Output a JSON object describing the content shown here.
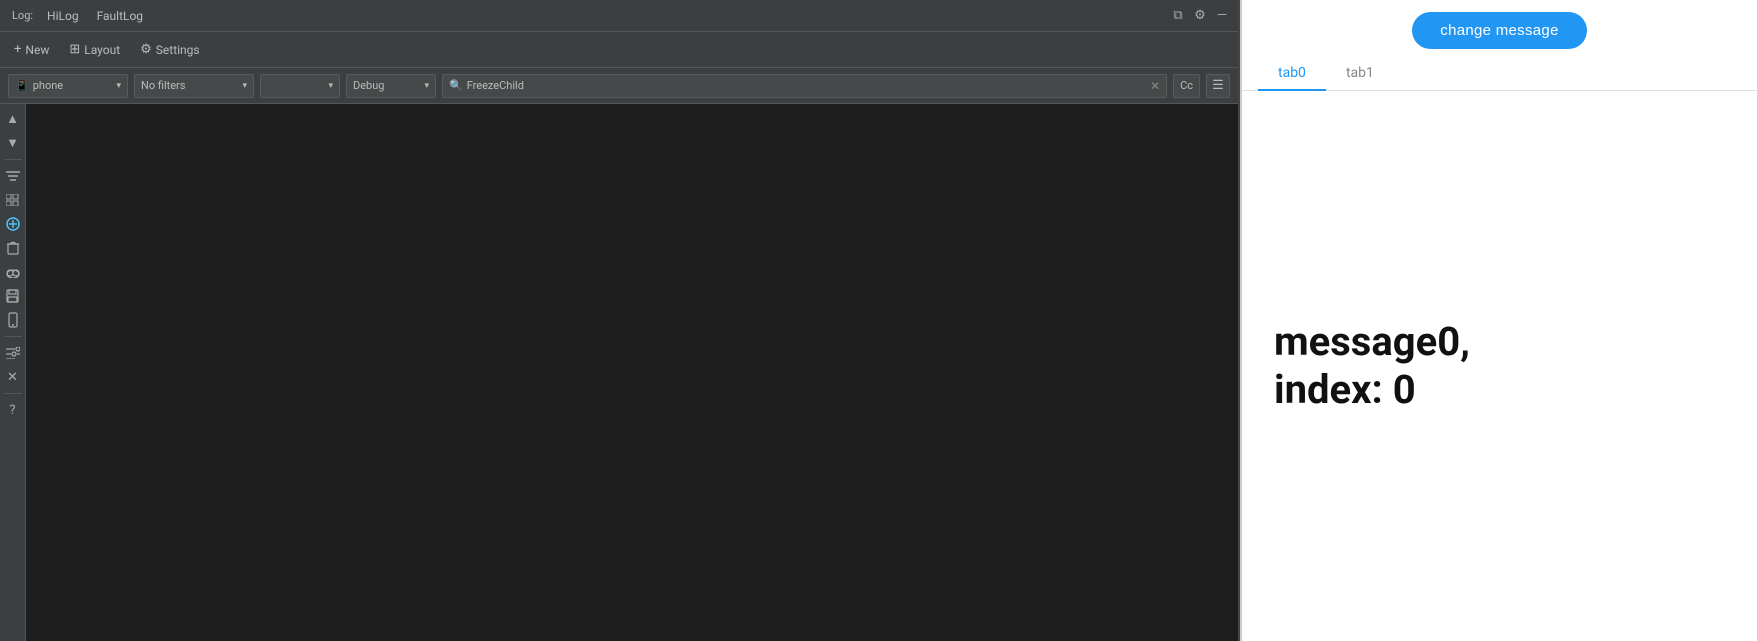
{
  "menu": {
    "app_label": "Log:",
    "hilog": "HiLog",
    "faultlog": "FaultLog",
    "window_buttons": {
      "restore": "⧉",
      "settings": "⚙",
      "minimize": "—"
    }
  },
  "toolbar": {
    "new_label": "New",
    "layout_label": "Layout",
    "settings_label": "Settings",
    "new_icon": "+",
    "layout_icon": "⊞",
    "settings_icon": "⚙"
  },
  "filter_bar": {
    "device_icon": "📱",
    "device_value": "phone",
    "device_arrow": "▾",
    "filter_value": "No filters",
    "filter_arrow": "▾",
    "package_value": "",
    "package_arrow": "▾",
    "level_value": "Debug",
    "level_arrow": "▾",
    "search_icon": "🔍",
    "search_value": "FreezeChild",
    "search_clear": "✕",
    "cc_label": "Cc",
    "filter_icon": "☰"
  },
  "sidebar": {
    "icons": [
      {
        "name": "arrow-up-icon",
        "symbol": "▲"
      },
      {
        "name": "arrow-down-icon",
        "symbol": "▼"
      },
      {
        "name": "filter-lines-icon",
        "symbol": "≡"
      },
      {
        "name": "grid-icon",
        "symbol": "⊞"
      },
      {
        "name": "add-circle-icon",
        "symbol": "⊕"
      },
      {
        "name": "trash-icon",
        "symbol": "🗑"
      },
      {
        "name": "cloud-icon",
        "symbol": "☁"
      },
      {
        "name": "save-icon",
        "symbol": "💾"
      },
      {
        "name": "device-icon",
        "symbol": "📱"
      },
      {
        "name": "list-icon",
        "symbol": "≡"
      },
      {
        "name": "close-icon",
        "symbol": "✕"
      },
      {
        "name": "help-icon",
        "symbol": "?"
      }
    ]
  },
  "right_panel": {
    "change_message_label": "change message",
    "tabs": [
      {
        "id": "tab0",
        "label": "tab0",
        "active": true
      },
      {
        "id": "tab1",
        "label": "tab1",
        "active": false
      }
    ],
    "message": "message0,\nindex: 0"
  }
}
